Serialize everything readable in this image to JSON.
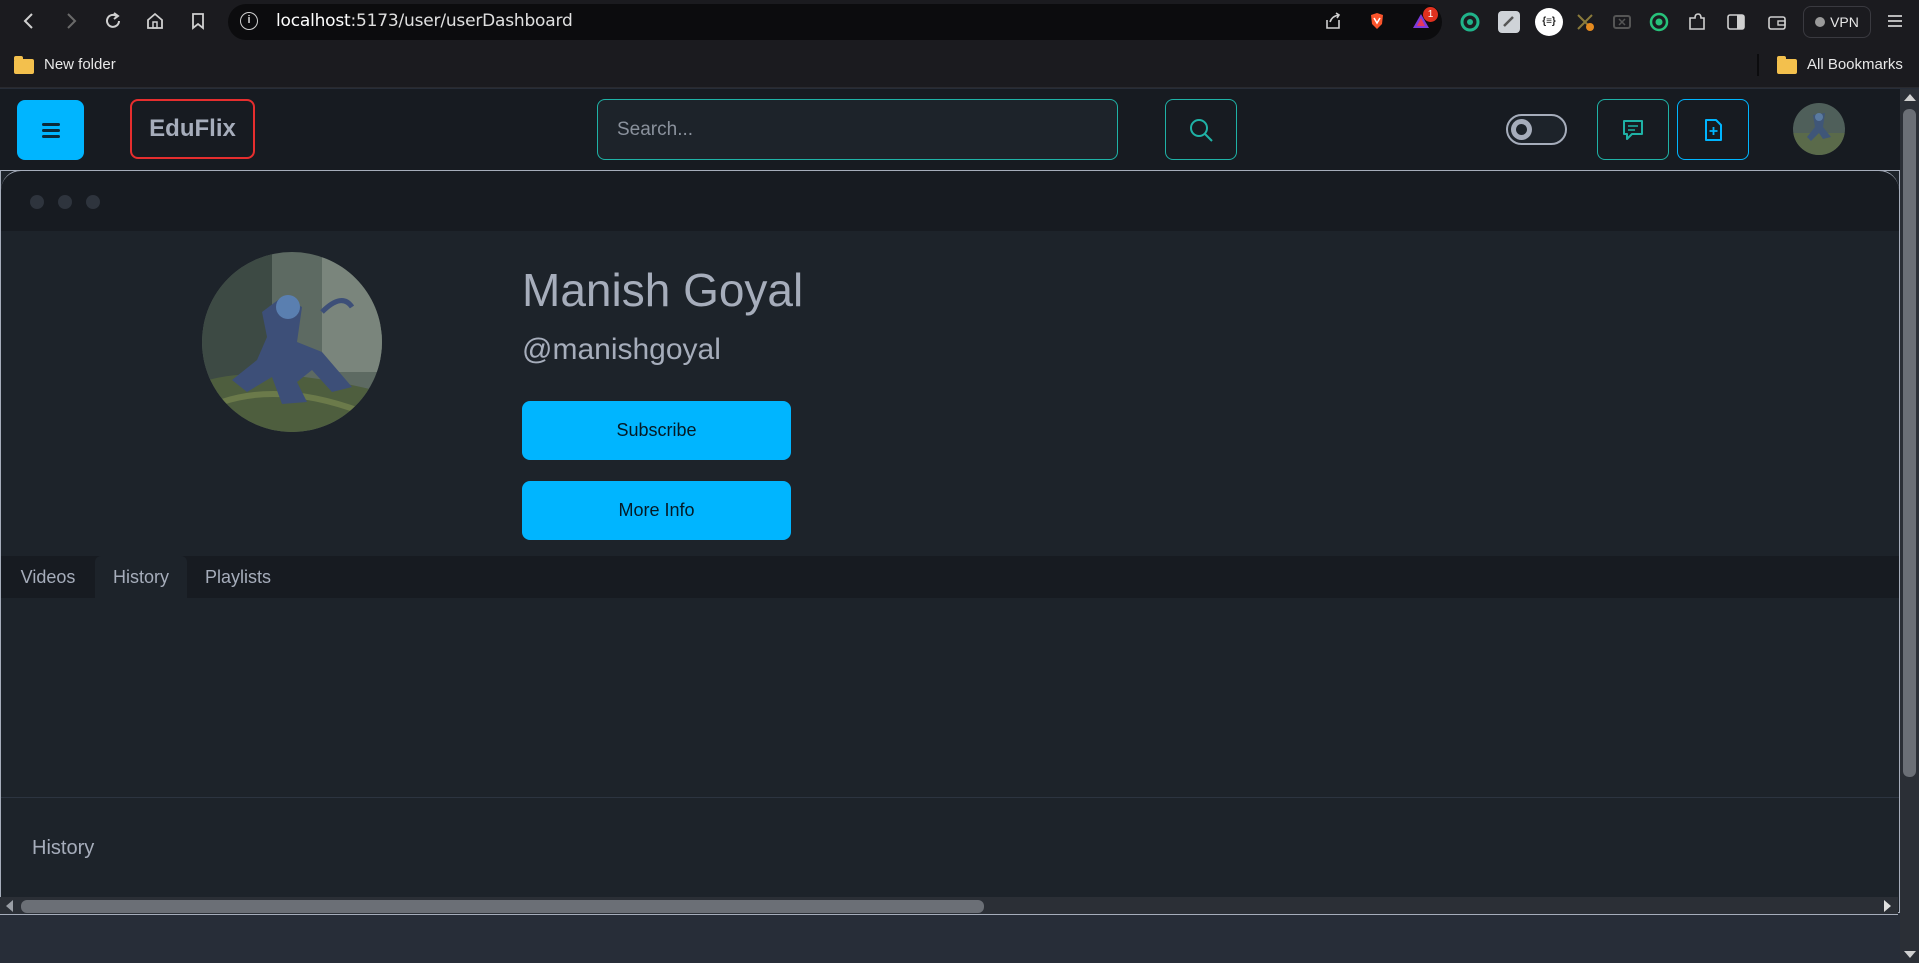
{
  "browser": {
    "url_host": "localhost",
    "url_path": ":5173/user/userDashboard",
    "notification_count": "1",
    "vpn_label": "VPN",
    "bookmarks": [
      {
        "label": "New folder"
      },
      {
        "label": "All Bookmarks"
      }
    ]
  },
  "navbar": {
    "brand": "EduFlix",
    "search_placeholder": "Search...",
    "accent_color": "#00b5ff",
    "border_color": "#1fb2a6"
  },
  "profile": {
    "name": "Manish Goyal",
    "handle": "@manishgoyal",
    "subscribe_label": "Subscribe",
    "more_info_label": "More Info"
  },
  "tabs": [
    {
      "label": "Videos",
      "active": false
    },
    {
      "label": "History",
      "active": true
    },
    {
      "label": "Playlists",
      "active": false
    }
  ],
  "panel": {
    "caption": "History"
  }
}
